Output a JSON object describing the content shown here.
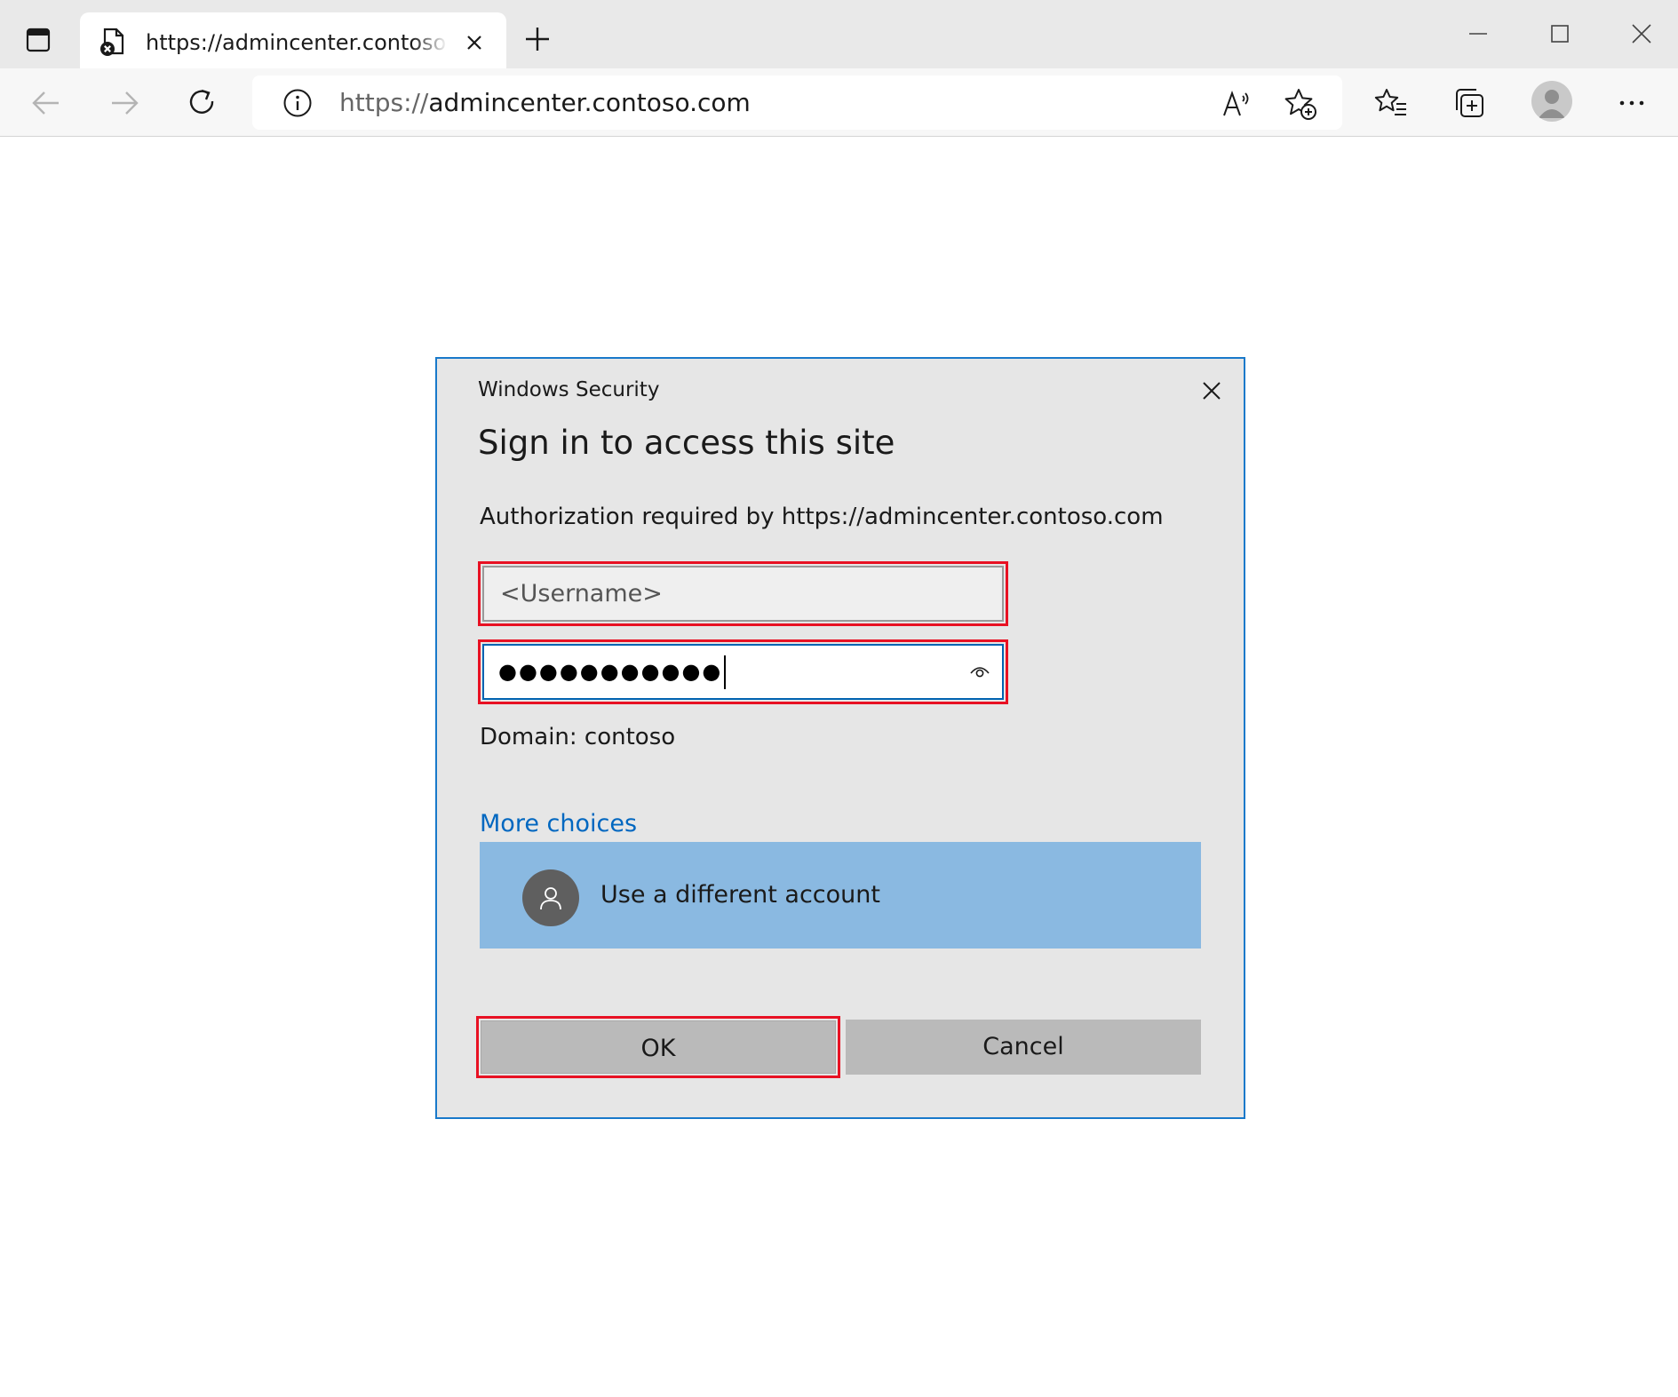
{
  "browser": {
    "tab": {
      "title": "https://admincenter.contoso.com"
    },
    "address": {
      "scheme": "https://",
      "host": "admincenter.contoso.com"
    }
  },
  "dialog": {
    "app_title": "Windows Security",
    "heading": "Sign in to access this site",
    "authorization": "Authorization required by https://admincenter.contoso.com",
    "username_placeholder": "<Username>",
    "password_masked": "●●●●●●●●●●●",
    "domain": "Domain: contoso",
    "more_choices": "More choices",
    "account_option": "Use a different account",
    "ok_label": "OK",
    "cancel_label": "Cancel"
  },
  "colors": {
    "dialog_border": "#1979ca",
    "highlight_red": "#e81123",
    "link_blue": "#0067c0",
    "option_selected": "#8ab9e1"
  }
}
